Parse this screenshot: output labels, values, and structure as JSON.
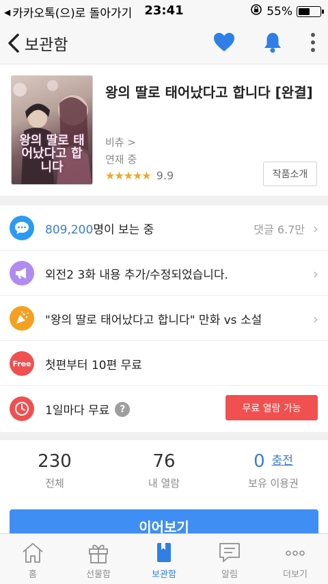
{
  "status_bar": {
    "back_app": "카카오톡(으)로 돌아가기",
    "time": "23:41",
    "battery": "55%",
    "battery_level": 0.55
  },
  "header": {
    "back_label": "보관함",
    "icons": [
      "heart-icon",
      "bell-icon",
      "more-vertical-icon"
    ]
  },
  "book": {
    "cover_text": "왕의 딸로 태어났다고 합니다",
    "title": "왕의 딸로 태어났다고 합니다 [완결]",
    "author": "비츄 >",
    "status": "연재 중",
    "stars": "★★★★★",
    "score": "9.9",
    "intro_button": "작품소개"
  },
  "rows": [
    {
      "icon": "chat-icon",
      "color": "#2b9af3",
      "number": "809,200",
      "text": "명이 보는 중",
      "side": "댓글 6.7만"
    },
    {
      "icon": "megaphone-icon",
      "color": "#b08cf0",
      "text": "외전2 3화 내용 추가/수정되었습니다."
    },
    {
      "icon": "party-icon",
      "color": "#f5a021",
      "text": "\"왕의 딸로 태어났다고 합니다\" 만화 vs 소설"
    },
    {
      "icon": "free-icon",
      "color": "#f05050",
      "badge": "Free",
      "text": "첫편부터 10편 무료"
    },
    {
      "icon": "clock-icon",
      "color": "#f05050",
      "text": "1일마다 무료",
      "help": "?",
      "button": "무료 열람 가능"
    }
  ],
  "stats": [
    {
      "value": "230",
      "label": "전체"
    },
    {
      "value": "76",
      "label": "내 열람"
    },
    {
      "value": "0",
      "link": "충전",
      "label": "보유 이용권"
    }
  ],
  "continue_button": "이어보기",
  "tabs": [
    {
      "label": "홈",
      "icon": "home-icon"
    },
    {
      "label": "선물함",
      "icon": "gift-icon"
    },
    {
      "label": "보관함",
      "icon": "bookmark-book-icon",
      "active": true
    },
    {
      "label": "알림",
      "icon": "message-icon"
    },
    {
      "label": "더보기",
      "icon": "more-horizontal-icon"
    }
  ],
  "colors": {
    "accent": "#2f7fe6",
    "button_blue": "#3f8ef4",
    "free_red": "#f05050",
    "star": "#f5a623"
  }
}
